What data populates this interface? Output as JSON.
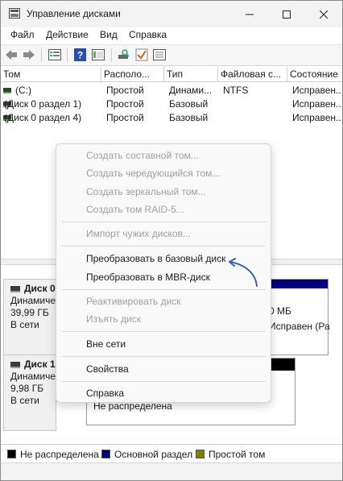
{
  "window": {
    "title": "Управление дисками"
  },
  "menu": [
    "Файл",
    "Действие",
    "Вид",
    "Справка"
  ],
  "toolbar_icons": [
    "back-arrow-icon",
    "forward-arrow-icon",
    "properties-list-icon",
    "help-icon",
    "console-icon",
    "disk-search-icon",
    "check-icon",
    "list-icon"
  ],
  "columns": [
    "Том",
    "Располо...",
    "Тип",
    "Файловая с...",
    "Состояние"
  ],
  "volumes": [
    {
      "name": "(C:)",
      "layout": "Простой",
      "type": "Динами...",
      "fs": "NTFS",
      "status": "Исправен..."
    },
    {
      "name": "(Диск 0 раздел 1)",
      "layout": "Простой",
      "type": "Базовый",
      "fs": "",
      "status": "Исправен..."
    },
    {
      "name": "(Диск 0 раздел 4)",
      "layout": "Простой",
      "type": "Базовый",
      "fs": "",
      "status": "Исправен..."
    }
  ],
  "disks": [
    {
      "name": "Диск 0",
      "type": "Динамиче",
      "size": "39,99 ГБ",
      "status": "В сети",
      "right_size": "0 МБ",
      "right_status": "Исправен (Ра"
    },
    {
      "name": "Диск 1",
      "type": "Динамиче",
      "size": "9,98 ГБ",
      "status": "В сети",
      "partition_status": "Не распределена"
    }
  ],
  "legend": [
    {
      "label": "Не распределена",
      "color": "#000000"
    },
    {
      "label": "Основной раздел",
      "color": "#000080"
    },
    {
      "label": "Простой том",
      "color": "#808000"
    }
  ],
  "context_menu": {
    "group1": [
      "Создать составной том...",
      "Создать чередующийся том...",
      "Создать зеркальный том...",
      "Создать том RAID-5..."
    ],
    "group2": [
      "Импорт чужих дисков..."
    ],
    "group3": [
      "Преобразовать в базовый диск",
      "Преобразовать в MBR-диск"
    ],
    "group4": [
      "Реактивировать диск",
      "Изъять диск"
    ],
    "offline": "Вне сети",
    "properties": "Свойства",
    "help": "Справка"
  },
  "colors": {
    "volume_bar": "#000080",
    "unallocated": "#000000",
    "arrow": "#3b5fb5"
  }
}
